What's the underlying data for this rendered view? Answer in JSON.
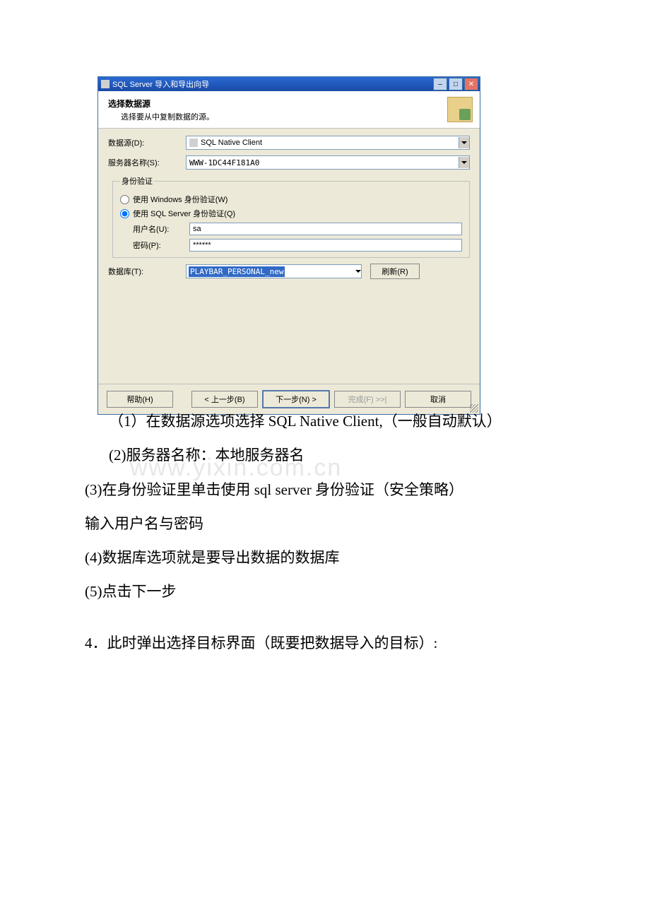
{
  "dialog": {
    "title": "SQL Server 导入和导出向导",
    "header_title": "选择数据源",
    "header_sub": "选择要从中复制数据的源。",
    "datasource_label": "数据源(D):",
    "datasource_value": "SQL Native Client",
    "server_label": "服务器名称(S):",
    "server_value": "WWW-1DC44F181A0",
    "auth_legend": "身份验证",
    "auth_win": "使用 Windows 身份验证(W)",
    "auth_sql": "使用 SQL Server 身份验证(Q)",
    "user_label": "用户名(U):",
    "user_value": "sa",
    "pwd_label": "密码(P):",
    "pwd_value": "******",
    "db_label": "数据库(T):",
    "db_value": "PLAYBAR_PERSONAL_new",
    "refresh": "刷新(R)",
    "help": "帮助(H)",
    "back": "< 上一步(B)",
    "next": "下一步(N) >",
    "finish": "完成(F) >>|",
    "cancel": "取消"
  },
  "doc": {
    "p1": "（1）在数据源选项选择 SQL Native Client,（一般自动默认）",
    "p2": "(2)服务器名称：本地服务器名",
    "p3": "(3)在身份验证里单击使用 sql server 身份验证（安全策略）",
    "p4": "输入用户名与密码",
    "p5": "(4)数据库选项就是要导出数据的数据库",
    "p6": "(5)点击下一步",
    "p7": "4．此时弹出选择目标界面（既要把数据导入的目标）:",
    "watermark": "www.yixin.com.cn"
  }
}
